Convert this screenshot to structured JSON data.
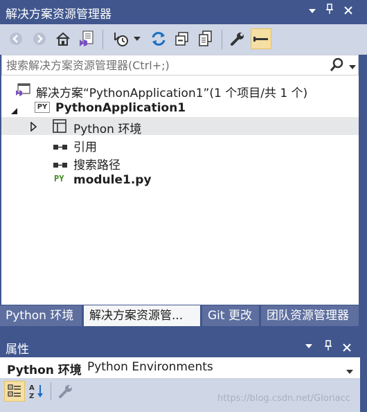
{
  "solution_explorer": {
    "title": "解决方案资源管理器",
    "search_placeholder": "搜索解决方案资源管理器(Ctrl+;)",
    "toolbar_icons": [
      "back-icon",
      "forward-icon",
      "home-icon",
      "vs-switch-view-icon",
      "pending-changes-icon",
      "dropdown-icon",
      "sync-icon",
      "collapse-all-icon",
      "show-all-files-icon",
      "properties-wrench-icon",
      "preview-selected-icon"
    ],
    "tree": {
      "solution_label": "解决方案“PythonApplication1”(1 个项目/共 1 个)",
      "project_label": "PythonApplication1",
      "project_badge": "PY",
      "environments_label": "Python 环境",
      "references_label": "引用",
      "search_paths_label": "搜索路径",
      "module_label": "module1.py",
      "module_badge": "PY"
    },
    "tabs": [
      {
        "label": "Python 环境",
        "active": false
      },
      {
        "label": "解决方案资源管...",
        "active": true
      },
      {
        "label": "Git 更改",
        "active": false
      },
      {
        "label": "团队资源管理器",
        "active": false
      }
    ]
  },
  "properties": {
    "title": "属性",
    "selected_object_bold": "Python 环境",
    "selected_object_type": "Python Environments",
    "toolbar_icons": [
      "categorized-icon",
      "alphabetical-icon",
      "property-pages-icon"
    ]
  },
  "watermark": "https://blog.csdn.net/Gloriacc",
  "colors": {
    "title_bar": "#40568d",
    "toolbar": "#cfd6e5",
    "active_button": "#f5dfa2",
    "selected_row": "#e6e7e8",
    "py_green": "#3c8a1e"
  }
}
